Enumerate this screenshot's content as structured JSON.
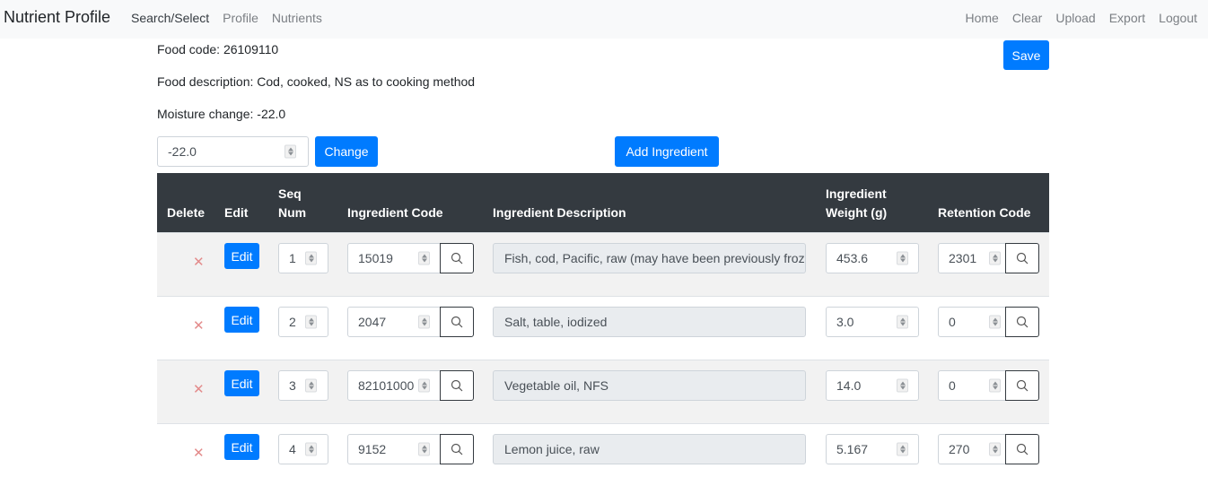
{
  "navbar": {
    "brand": "Nutrient Profile",
    "left_links": [
      {
        "label": "Search/Select",
        "active": true
      },
      {
        "label": "Profile",
        "active": false
      },
      {
        "label": "Nutrients",
        "active": false
      }
    ],
    "right_links": [
      "Home",
      "Clear",
      "Upload",
      "Export",
      "Logout"
    ]
  },
  "food": {
    "code_line": "Food code: 26109110",
    "description_line": "Food description: Cod, cooked, NS as to cooking method",
    "moisture_line": "Moisture change: -22.0"
  },
  "actions": {
    "save_label": "Save",
    "moisture_input_value": "-22.0",
    "change_label": "Change",
    "add_ingredient_label": "Add Ingredient"
  },
  "table": {
    "headers": {
      "delete": "Delete",
      "edit": "Edit",
      "seq_line1": "Seq",
      "seq_line2": "Num",
      "ingredient_code": "Ingredient Code",
      "ingredient_description": "Ingredient Description",
      "weight_line1": "Ingredient",
      "weight_line2": "Weight (g)",
      "retention_code": "Retention Code"
    },
    "delete_symbol": "✕",
    "edit_label": "Edit",
    "rows": [
      {
        "seq": "1",
        "code": "15019",
        "description": "Fish, cod, Pacific, raw (may have been previously frozen)",
        "weight": "453.6",
        "retention": "2301"
      },
      {
        "seq": "2",
        "code": "2047",
        "description": "Salt, table, iodized",
        "weight": "3.0",
        "retention": "0"
      },
      {
        "seq": "3",
        "code": "82101000",
        "description": "Vegetable oil, NFS",
        "weight": "14.0",
        "retention": "0"
      },
      {
        "seq": "4",
        "code": "9152",
        "description": "Lemon juice, raw",
        "weight": "5.167",
        "retention": "270"
      }
    ]
  },
  "colors": {
    "primary": "#007bff",
    "table_header": "#343a40",
    "navbar_bg": "#f8f9fa",
    "delete_icon": "#e38b8b"
  }
}
